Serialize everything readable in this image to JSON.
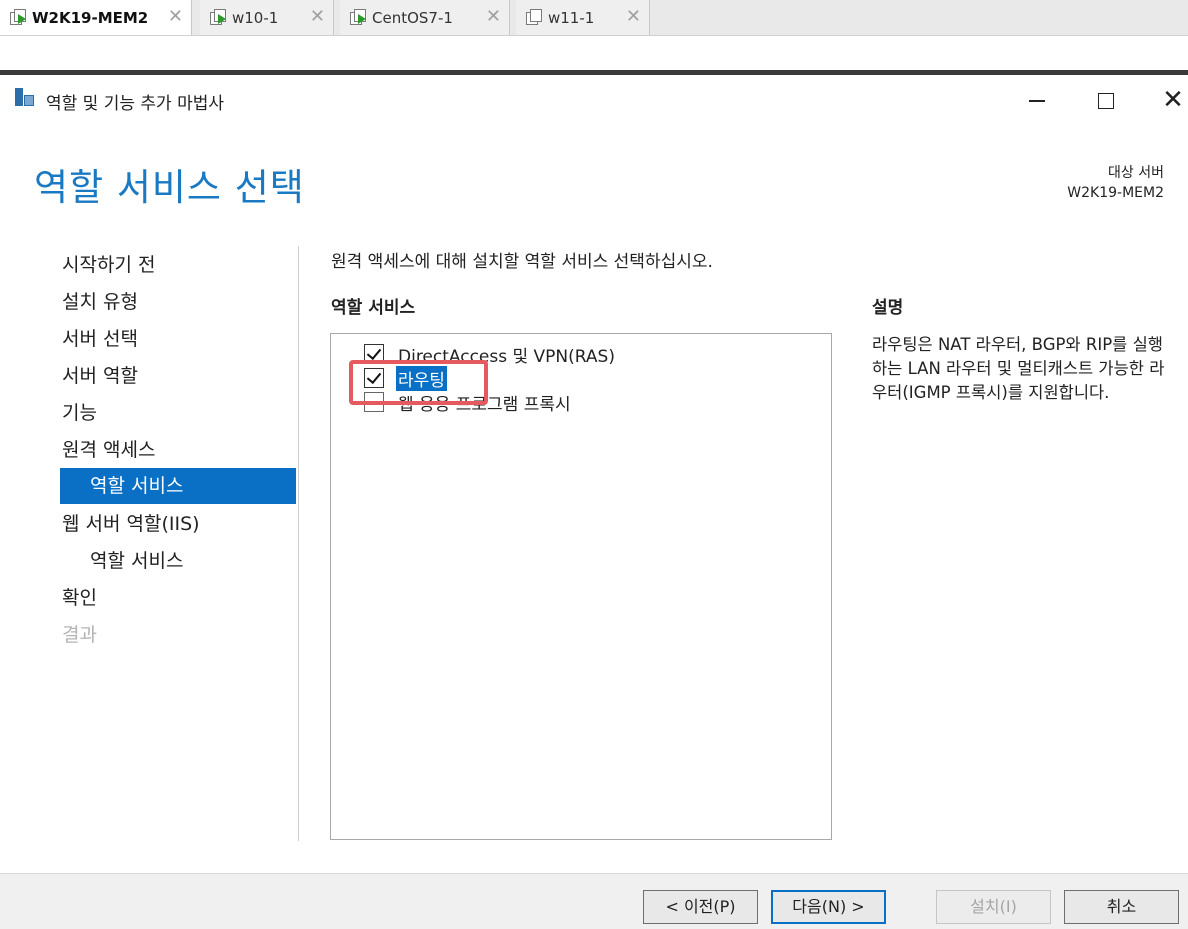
{
  "vm_tabs": [
    {
      "label": "W2K19-MEM2",
      "active": true,
      "running": true
    },
    {
      "label": "w10-1",
      "active": false,
      "running": true
    },
    {
      "label": "CentOS7-1",
      "active": false,
      "running": true
    },
    {
      "label": "w11-1",
      "active": false,
      "running": false
    }
  ],
  "tab_close_glyph": "✕",
  "dialog": {
    "title": "역할 및 기능 추가 마법사",
    "close_glyph": "✕"
  },
  "page": {
    "title": "역할 서비스 선택",
    "destination_label": "대상 서버",
    "destination_server": "W2K19-MEM2",
    "instruction": "원격 액세스에 대해 설치할 역할 서비스 선택하십시오.",
    "role_services_header": "역할 서비스",
    "description_header": "설명",
    "description_text": "라우팅은 NAT 라우터, BGP와 RIP를 실행하는 LAN 라우터 및 멀티캐스트 가능한 라우터(IGMP 프록시)를 지원합니다."
  },
  "nav": [
    {
      "label": "시작하기 전",
      "sub": false,
      "selected": false,
      "disabled": false
    },
    {
      "label": "설치 유형",
      "sub": false,
      "selected": false,
      "disabled": false
    },
    {
      "label": "서버 선택",
      "sub": false,
      "selected": false,
      "disabled": false
    },
    {
      "label": "서버 역할",
      "sub": false,
      "selected": false,
      "disabled": false
    },
    {
      "label": "기능",
      "sub": false,
      "selected": false,
      "disabled": false
    },
    {
      "label": "원격 액세스",
      "sub": false,
      "selected": false,
      "disabled": false
    },
    {
      "label": "역할 서비스",
      "sub": true,
      "selected": true,
      "disabled": false
    },
    {
      "label": "웹 서버 역할(IIS)",
      "sub": false,
      "selected": false,
      "disabled": false
    },
    {
      "label": "역할 서비스",
      "sub": true,
      "selected": false,
      "disabled": false
    },
    {
      "label": "확인",
      "sub": false,
      "selected": false,
      "disabled": false
    },
    {
      "label": "결과",
      "sub": false,
      "selected": false,
      "disabled": true
    }
  ],
  "role_services": [
    {
      "label": "DirectAccess 및 VPN(RAS)",
      "checked": true,
      "highlighted": false
    },
    {
      "label": "라우팅",
      "checked": true,
      "highlighted": true
    },
    {
      "label": "웹 응용 프로그램 프록시",
      "checked": false,
      "highlighted": false
    }
  ],
  "buttons": {
    "previous": "< 이전(P)",
    "next": "다음(N) >",
    "install": "설치(I)",
    "cancel": "취소"
  },
  "colors": {
    "accent": "#0a70c6",
    "title_blue": "#1979c3",
    "annotation_red": "#e55a5f"
  }
}
